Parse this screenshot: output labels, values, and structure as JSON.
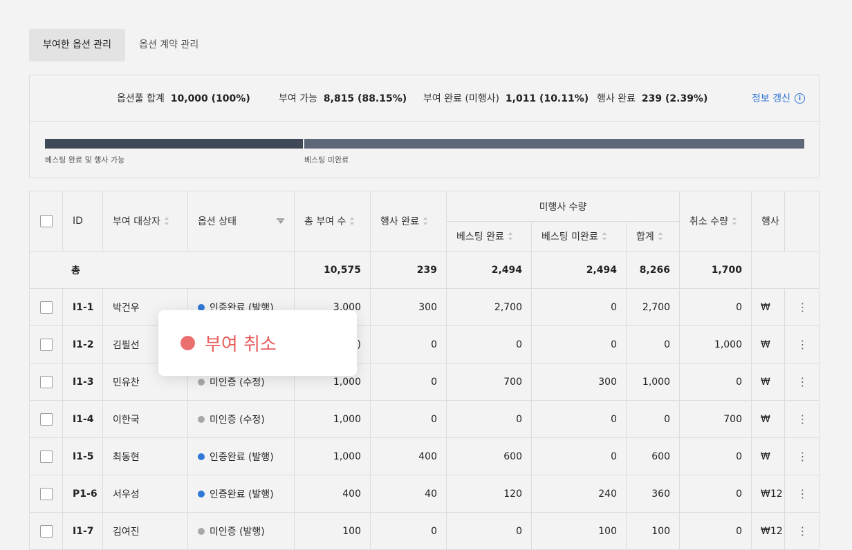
{
  "tabs": [
    {
      "label": "부여한 옵션 관리",
      "active": true
    },
    {
      "label": "옵션 계약 관리",
      "active": false
    }
  ],
  "summary": {
    "pool_label": "옵션풀 합계",
    "pool_value": "10,000 (100%)",
    "avail_label": "부여 가능",
    "avail_value": "8,815 (88.15%)",
    "granted_label": "부여 완료 (미행사)",
    "granted_value": "1,011 (10.11%)",
    "exercised_label": "행사 완료",
    "exercised_value": "239 (2.39%)",
    "refresh_label": "정보 갱신",
    "info_icon_glyph": "i",
    "bar_label_done": "베스팅 완료 및 행사 가능",
    "bar_label_notdone": "베스팅 미완료",
    "vested_fraction": 0.34
  },
  "table": {
    "headers": {
      "id": "ID",
      "grantee": "부여 대상자",
      "status": "옵션 상태",
      "total": "총 부여 수",
      "exercised": "행사 완료",
      "unexercised_group": "미행사 수량",
      "vested": "베스팅 완료",
      "unvested": "베스팅 미완료",
      "sum": "합계",
      "cancelled": "취소 수량",
      "exercise": "행사"
    },
    "total_row": {
      "label": "총",
      "total": "10,575",
      "exercised": "239",
      "vested": "2,494",
      "unvested": "2,494",
      "sum": "8,266",
      "cancelled": "1,700"
    },
    "rows": [
      {
        "id": "I1-1",
        "name": "박건우",
        "status": "인증완료 (발행)",
        "status_color": "#2f78d8",
        "total": "3,000",
        "exercised": "300",
        "vested": "2,700",
        "unvested": "0",
        "sum": "2,700",
        "cancelled": "0",
        "exercise": "₩"
      },
      {
        "id": "I1-2",
        "name": "김필선",
        "status": "",
        "status_color": "#a8a8a8",
        "total": ")",
        "exercised": "0",
        "vested": "0",
        "unvested": "0",
        "sum": "0",
        "cancelled": "1,000",
        "exercise": "₩"
      },
      {
        "id": "I1-3",
        "name": "민유찬",
        "status": "미인증 (수정)",
        "status_color": "#a8a8a8",
        "total": "1,000",
        "exercised": "0",
        "vested": "700",
        "unvested": "300",
        "sum": "1,000",
        "cancelled": "0",
        "exercise": "₩"
      },
      {
        "id": "I1-4",
        "name": "이한국",
        "status": "미인증 (수정)",
        "status_color": "#a8a8a8",
        "total": "1,000",
        "exercised": "0",
        "vested": "0",
        "unvested": "0",
        "sum": "0",
        "cancelled": "700",
        "exercise": "₩"
      },
      {
        "id": "I1-5",
        "name": "최동현",
        "status": "인증완료 (발행)",
        "status_color": "#2f78d8",
        "total": "1,000",
        "exercised": "400",
        "vested": "600",
        "unvested": "0",
        "sum": "600",
        "cancelled": "0",
        "exercise": "₩"
      },
      {
        "id": "P1-6",
        "name": "서우성",
        "status": "인증완료 (발행)",
        "status_color": "#2f78d8",
        "total": "400",
        "exercised": "40",
        "vested": "120",
        "unvested": "240",
        "sum": "360",
        "cancelled": "0",
        "exercise": "₩12"
      },
      {
        "id": "I1-7",
        "name": "김여진",
        "status": "미인증 (발행)",
        "status_color": "#a8a8a8",
        "total": "100",
        "exercised": "0",
        "vested": "0",
        "unvested": "100",
        "sum": "100",
        "cancelled": "0",
        "exercise": "₩12"
      }
    ],
    "more_glyph": "⋮"
  },
  "popup": {
    "label": "부여 취소",
    "dot_color": "#ec6f6f"
  }
}
